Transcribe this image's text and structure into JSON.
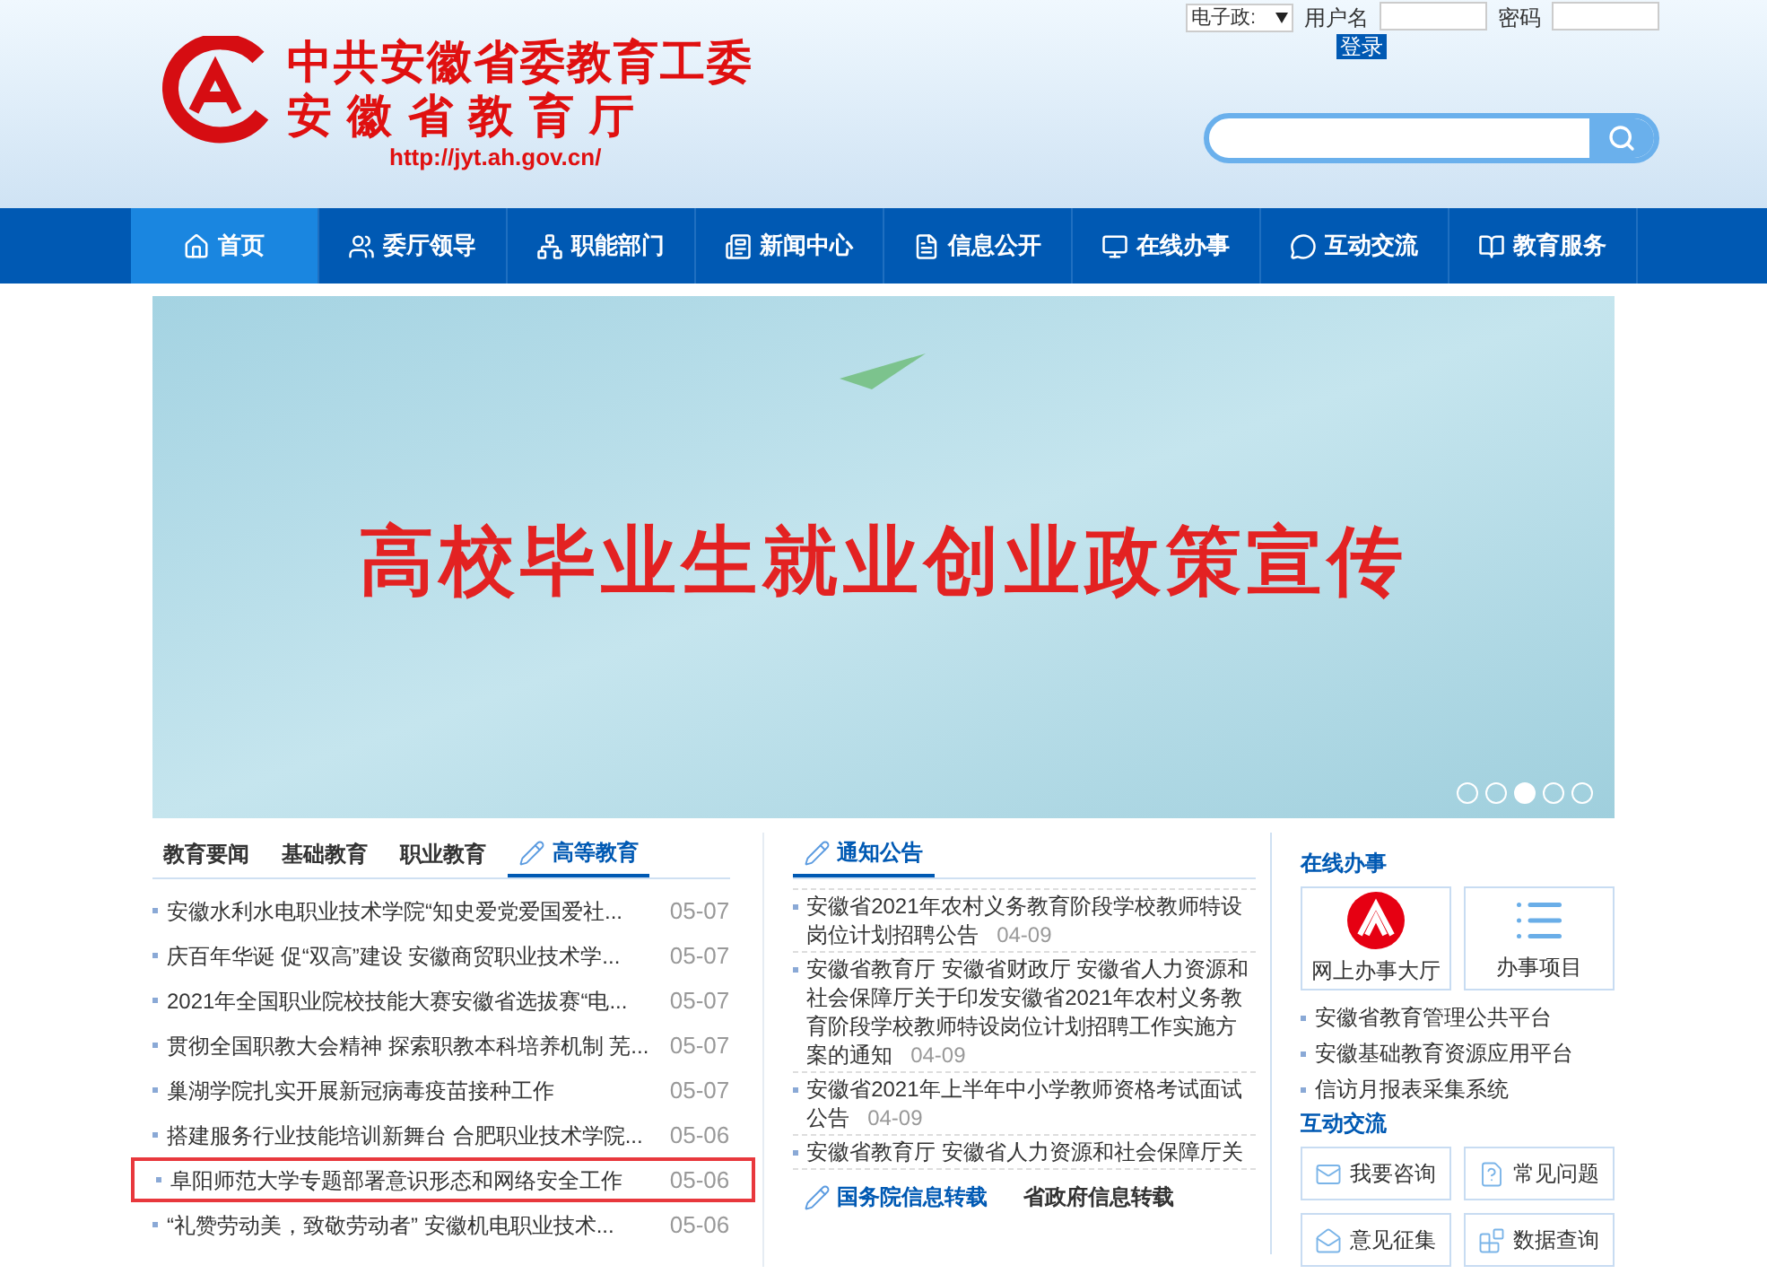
{
  "header": {
    "title_line1": "中共安徽省委教育工委",
    "title_line2": "安 徽 省 教 育 厅",
    "url": "http://jyt.ah.gov.cn/",
    "login": {
      "system_select": "电子政:",
      "username_label": "用户名",
      "password_label": "密码",
      "login_button": "登录"
    }
  },
  "nav": [
    {
      "label": "首页",
      "selected": true
    },
    {
      "label": "委厅领导",
      "selected": false
    },
    {
      "label": "职能部门",
      "selected": false
    },
    {
      "label": "新闻中心",
      "selected": false
    },
    {
      "label": "信息公开",
      "selected": false
    },
    {
      "label": "在线办事",
      "selected": false
    },
    {
      "label": "互动交流",
      "selected": false
    },
    {
      "label": "教育服务",
      "selected": false
    }
  ],
  "banner": {
    "headline": "高校毕业生就业创业政策宣传",
    "dots": [
      {
        "selected": false
      },
      {
        "selected": false
      },
      {
        "selected": true
      },
      {
        "selected": false
      },
      {
        "selected": false
      }
    ]
  },
  "news": {
    "tabs": [
      {
        "label": "教育要闻",
        "selected": false
      },
      {
        "label": "基础教育",
        "selected": false
      },
      {
        "label": "职业教育",
        "selected": false
      },
      {
        "label": "高等教育",
        "selected": true
      }
    ],
    "items": [
      {
        "title": "安徽水利水电职业技术学院“知史爱党爱国爱社...",
        "date": "05-07",
        "highlighted": false
      },
      {
        "title": "庆百年华诞 促“双高”建设 安徽商贸职业技术学...",
        "date": "05-07",
        "highlighted": false
      },
      {
        "title": "2021年全国职业院校技能大赛安徽省选拔赛“电...",
        "date": "05-07",
        "highlighted": false
      },
      {
        "title": "贯彻全国职教大会精神 探索职教本科培养机制 芜...",
        "date": "05-07",
        "highlighted": false
      },
      {
        "title": "巢湖学院扎实开展新冠病毒疫苗接种工作",
        "date": "05-07",
        "highlighted": false
      },
      {
        "title": "搭建服务行业技能培训新舞台 合肥职业技术学院...",
        "date": "05-06",
        "highlighted": false
      },
      {
        "title": "阜阳师范大学专题部署意识形态和网络安全工作",
        "date": "05-06",
        "highlighted": true
      },
      {
        "title": "“礼赞劳动美，致敬劳动者” 安徽机电职业技术...",
        "date": "05-06",
        "highlighted": false
      }
    ]
  },
  "notices": {
    "title": "通知公告",
    "items": [
      {
        "title": "安徽省2021年农村义务教育阶段学校教师特设岗位计划招聘公告",
        "date": "04-09"
      },
      {
        "title": "安徽省教育厅 安徽省财政厅 安徽省人力资源和社会保障厅关于印发安徽省2021年农村义务教育阶段学校教师特设岗位计划招聘工作实施方案的通知",
        "date": "04-09"
      },
      {
        "title": "安徽省2021年上半年中小学教师资格考试面试公告",
        "date": "04-09"
      },
      {
        "title": "安徽省教育厅 安徽省人力资源和社会保障厅关"
      }
    ],
    "tabs": [
      {
        "label": "国务院信息转载",
        "selected": true
      },
      {
        "label": "省政府信息转载",
        "selected": false
      }
    ]
  },
  "online": {
    "title": "在线办事",
    "tiles": [
      {
        "label": "网上办事大厅"
      },
      {
        "label": "办事项目"
      }
    ],
    "links": [
      "安徽省教育管理公共平台",
      "安徽基础教育资源应用平台",
      "信访月报表采集系统"
    ]
  },
  "interaction": {
    "title": "互动交流",
    "buttons": [
      {
        "label": "我要咨询"
      },
      {
        "label": "常见问题"
      },
      {
        "label": "意见征集"
      },
      {
        "label": "数据查询"
      }
    ]
  }
}
